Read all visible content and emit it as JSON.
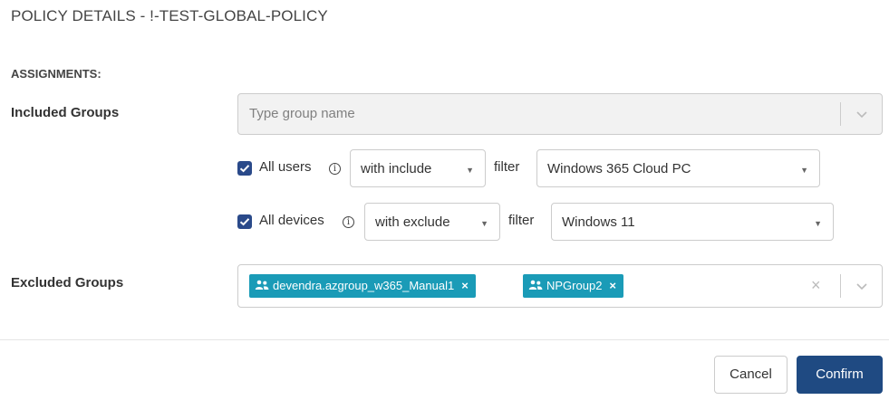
{
  "dialog": {
    "title": "POLICY DETAILS - !-TEST-GLOBAL-POLICY",
    "section_heading": "ASSIGNMENTS:"
  },
  "included": {
    "label": "Included Groups",
    "placeholder": "Type group name",
    "all_users": {
      "checked": true,
      "label": "All users",
      "mode": "with include",
      "filter_label": "filter",
      "filter_value": "Windows 365 Cloud PC"
    },
    "all_devices": {
      "checked": true,
      "label": "All devices",
      "mode": "with exclude",
      "filter_label": "filter",
      "filter_value": "Windows 11"
    }
  },
  "excluded": {
    "label": "Excluded Groups",
    "tags": [
      {
        "name": "devendra.azgroup_w365_Manual1",
        "remove": "×",
        "icon": "group-icon"
      },
      {
        "name": "NPGroup2",
        "remove": "×",
        "icon": "group-icon"
      }
    ],
    "clear": "×"
  },
  "footer": {
    "cancel_label": "Cancel",
    "confirm_label": "Confirm"
  },
  "colors": {
    "accent": "#1f4a82",
    "tag": "#1a9bb7",
    "checkbox": "#2a4a8a"
  },
  "icons": {
    "info": "info-icon",
    "chevron": "chevron-down-icon",
    "caret": "caret-down-icon"
  }
}
